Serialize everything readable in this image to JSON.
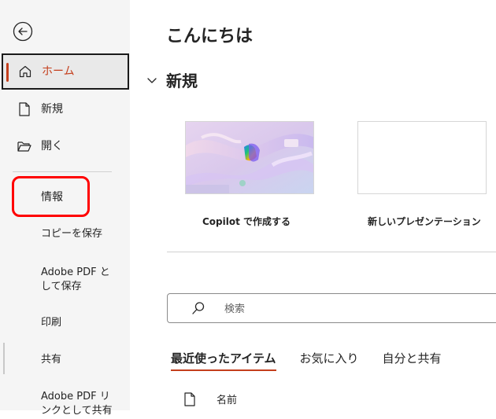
{
  "sidebar": {
    "back_icon": "back-arrow-circle-icon",
    "items": [
      {
        "label": "ホーム",
        "icon": "home-icon"
      },
      {
        "label": "新規",
        "icon": "new-document-icon"
      },
      {
        "label": "開く",
        "icon": "open-folder-icon"
      },
      {
        "label": "情報"
      },
      {
        "label": "コピーを保存"
      },
      {
        "label_line1": "Adobe PDF と",
        "label_line2": "して保存"
      },
      {
        "label": "印刷"
      },
      {
        "label": "共有"
      },
      {
        "label_line1": "Adobe PDF リ",
        "label_line2": "ンクとして共有"
      }
    ]
  },
  "main": {
    "greeting": "こんにちは",
    "new_section_title": "新規",
    "templates": [
      {
        "label": "Copilot で作成する"
      },
      {
        "label": "新しいプレゼンテーション"
      }
    ],
    "search": {
      "placeholder": "検索",
      "value": ""
    },
    "tabs": [
      {
        "label": "最近使ったアイテム",
        "active": true
      },
      {
        "label": "お気に入り",
        "active": false
      },
      {
        "label": "自分と共有",
        "active": false
      }
    ],
    "list_header": {
      "name_label": "名前"
    }
  },
  "colors": {
    "accent": "#c43e1c",
    "highlight": "#ff0000",
    "sidebar_bg": "#f5f5f5"
  }
}
